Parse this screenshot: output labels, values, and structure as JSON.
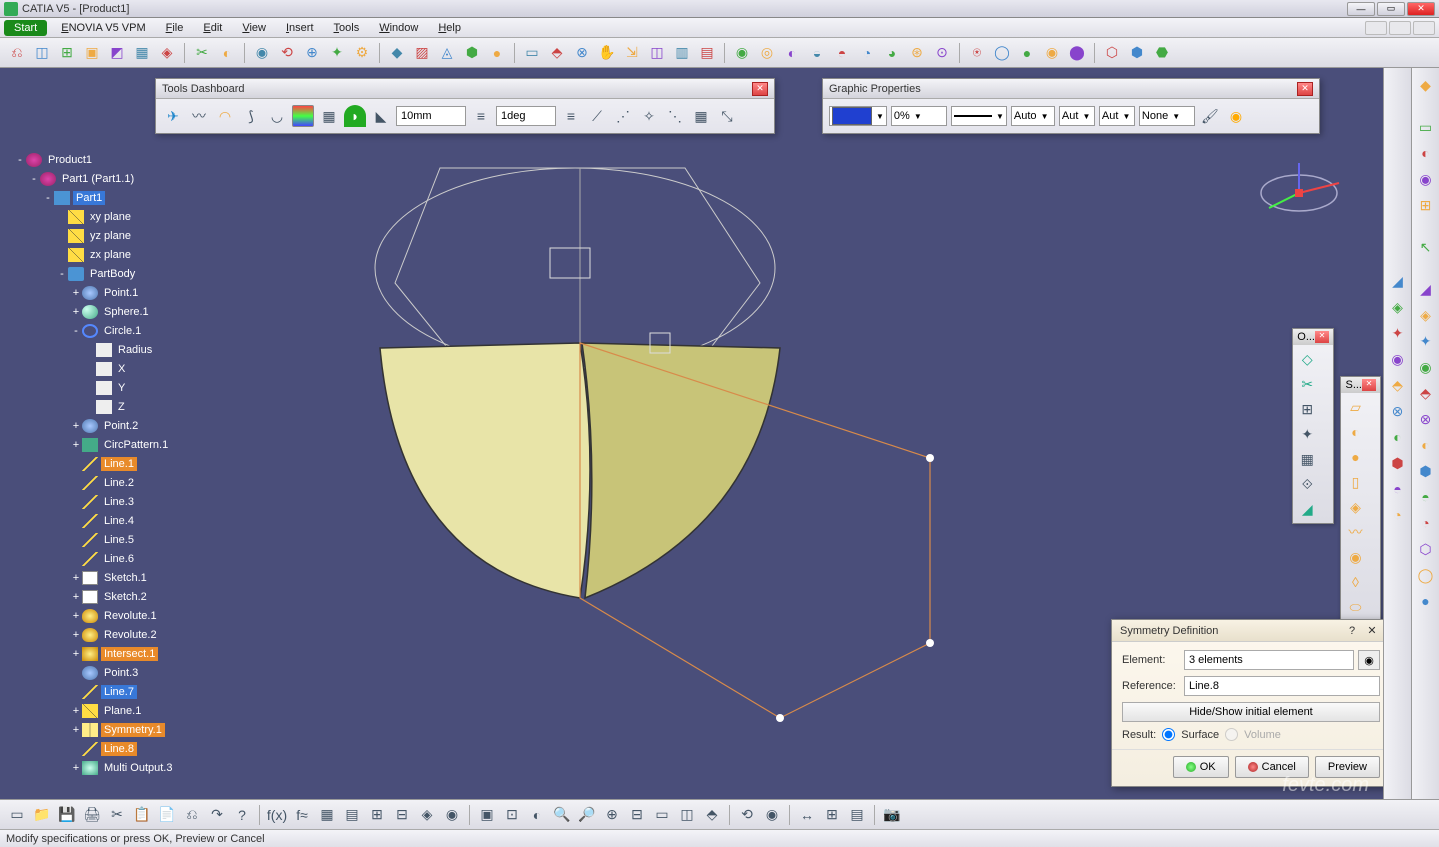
{
  "titlebar": {
    "title": "CATIA V5 - [Product1]"
  },
  "menus": [
    "Start",
    "ENOVIA V5 VPM",
    "File",
    "Edit",
    "View",
    "Insert",
    "Tools",
    "Window",
    "Help"
  ],
  "tools_dashboard": {
    "title": "Tools Dashboard",
    "length": "10mm",
    "angle": "1deg"
  },
  "graphic_properties": {
    "title": "Graphic Properties",
    "thickness": "0%",
    "auto1": "Auto",
    "auto2": "Aut",
    "auto3": "Aut",
    "layer": "None"
  },
  "palette_o": "O...",
  "palette_s": "S...",
  "tree": [
    {
      "d": 0,
      "e": "-",
      "i": "ti-gear",
      "t": "Product1"
    },
    {
      "d": 1,
      "e": "-",
      "i": "ti-gear",
      "t": "Part1 (Part1.1)"
    },
    {
      "d": 2,
      "e": "-",
      "i": "ti-part",
      "t": "Part1",
      "sel": "blue"
    },
    {
      "d": 3,
      "e": "",
      "i": "ti-plane",
      "t": "xy plane"
    },
    {
      "d": 3,
      "e": "",
      "i": "ti-plane",
      "t": "yz plane"
    },
    {
      "d": 3,
      "e": "",
      "i": "ti-plane",
      "t": "zx plane"
    },
    {
      "d": 3,
      "e": "-",
      "i": "ti-body",
      "t": "PartBody"
    },
    {
      "d": 4,
      "e": "+",
      "i": "ti-point",
      "t": "Point.1"
    },
    {
      "d": 4,
      "e": "+",
      "i": "ti-sphere",
      "t": "Sphere.1"
    },
    {
      "d": 4,
      "e": "-",
      "i": "ti-circle",
      "t": "Circle.1"
    },
    {
      "d": 5,
      "e": "",
      "i": "ti-formula",
      "t": "Radius"
    },
    {
      "d": 5,
      "e": "",
      "i": "ti-formula",
      "t": "X"
    },
    {
      "d": 5,
      "e": "",
      "i": "ti-formula",
      "t": "Y"
    },
    {
      "d": 5,
      "e": "",
      "i": "ti-formula",
      "t": "Z"
    },
    {
      "d": 4,
      "e": "+",
      "i": "ti-point",
      "t": "Point.2"
    },
    {
      "d": 4,
      "e": "+",
      "i": "ti-pattern",
      "t": "CircPattern.1"
    },
    {
      "d": 4,
      "e": "",
      "i": "ti-line",
      "t": "Line.1",
      "sel": "orange"
    },
    {
      "d": 4,
      "e": "",
      "i": "ti-line",
      "t": "Line.2"
    },
    {
      "d": 4,
      "e": "",
      "i": "ti-line",
      "t": "Line.3"
    },
    {
      "d": 4,
      "e": "",
      "i": "ti-line",
      "t": "Line.4"
    },
    {
      "d": 4,
      "e": "",
      "i": "ti-line",
      "t": "Line.5"
    },
    {
      "d": 4,
      "e": "",
      "i": "ti-line",
      "t": "Line.6"
    },
    {
      "d": 4,
      "e": "+",
      "i": "ti-sketch",
      "t": "Sketch.1"
    },
    {
      "d": 4,
      "e": "+",
      "i": "ti-sketch",
      "t": "Sketch.2"
    },
    {
      "d": 4,
      "e": "+",
      "i": "ti-rev",
      "t": "Revolute.1"
    },
    {
      "d": 4,
      "e": "+",
      "i": "ti-rev",
      "t": "Revolute.2"
    },
    {
      "d": 4,
      "e": "+",
      "i": "ti-inter",
      "t": "Intersect.1",
      "sel": "orange"
    },
    {
      "d": 4,
      "e": "",
      "i": "ti-point",
      "t": "Point.3"
    },
    {
      "d": 4,
      "e": "",
      "i": "ti-line",
      "t": "Line.7",
      "sel": "blue"
    },
    {
      "d": 4,
      "e": "+",
      "i": "ti-plane",
      "t": "Plane.1"
    },
    {
      "d": 4,
      "e": "+",
      "i": "ti-sym",
      "t": "Symmetry.1",
      "sel": "orange"
    },
    {
      "d": 4,
      "e": "",
      "i": "ti-line",
      "t": "Line.8",
      "sel": "orange"
    },
    {
      "d": 4,
      "e": "+",
      "i": "ti-multi",
      "t": "Multi Output.3"
    }
  ],
  "symmetry": {
    "title": "Symmetry Definition",
    "element_label": "Element:",
    "element_value": "3 elements",
    "reference_label": "Reference:",
    "reference_value": "Line.8",
    "hideshow": "Hide/Show initial element",
    "result_label": "Result:",
    "surface": "Surface",
    "volume": "Volume",
    "ok": "OK",
    "cancel": "Cancel",
    "preview": "Preview"
  },
  "status": "Modify specifications or press OK, Preview or Cancel",
  "watermark": "fevte.com"
}
